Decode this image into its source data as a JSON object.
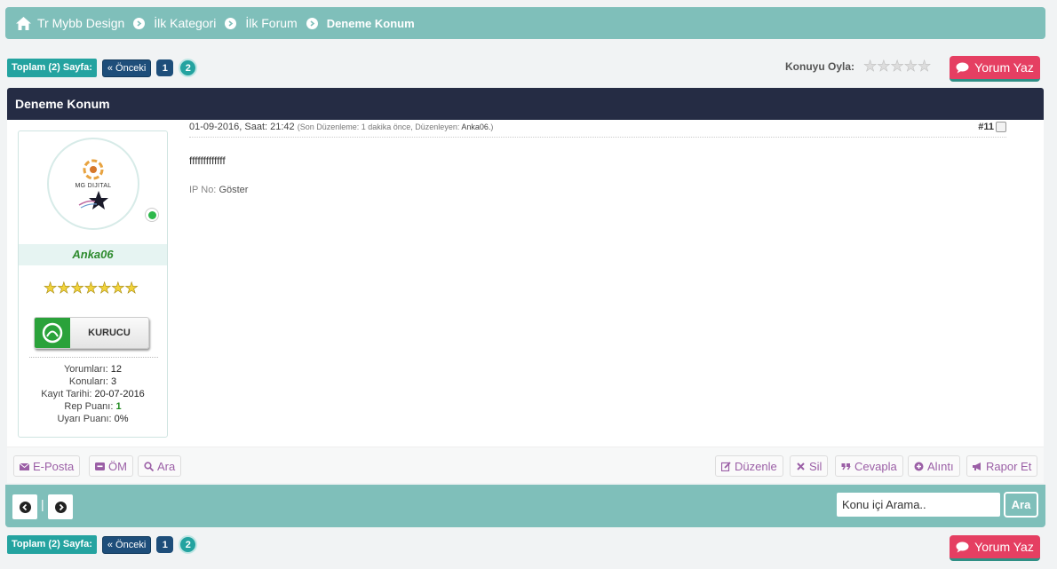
{
  "breadcrumb": {
    "items": [
      "Tr Mybb Design",
      "İlk Kategori",
      "İlk Forum"
    ],
    "current": "Deneme Konum"
  },
  "pagination": {
    "label": "Toplam (2) Sayfa:",
    "prev": "« Önceki",
    "pages": [
      "1",
      "2"
    ],
    "current_page": "2"
  },
  "rating": {
    "label": "Konuyu Oyla:",
    "stars_total": 5,
    "stars_filled": 0
  },
  "reply_button": "Yorum Yaz",
  "post": {
    "thread_title": "Deneme Konum",
    "date": "01-09-2016, Saat: 21:42",
    "edit_info": "(Son Düzenleme: 1 dakika önce, Düzenleyen:",
    "edit_user": "Anka06.",
    "edit_close": ")",
    "number": "#11",
    "content": "fffffffffffff",
    "ip_label": "IP No:",
    "ip_value": "Göster"
  },
  "author": {
    "avatar_text": "MG DIJITAL",
    "username": "Anka06",
    "online": true,
    "stars": 7,
    "rank": "KURUCU",
    "stats": {
      "posts_label": "Yorumları:",
      "posts": "12",
      "threads_label": "Konuları:",
      "threads": "3",
      "reg_label": "Kayıt Tarihi:",
      "reg": "20-07-2016",
      "rep_label": "Rep Puanı:",
      "rep": "1",
      "warn_label": "Uyarı Puanı:",
      "warn": "0%"
    }
  },
  "actions": {
    "email": "E-Posta",
    "pm": "ÖM",
    "search": "Ara",
    "edit": "Düzenle",
    "delete": "Sil",
    "reply": "Cevapla",
    "quote": "Alıntı",
    "report": "Rapor Et"
  },
  "thread_search": {
    "placeholder": "Konu içi Arama..",
    "button": "Ara",
    "separator": "|"
  },
  "colors": {
    "accent": "#7fbfba",
    "header": "#252c44",
    "reply": "#e53f62",
    "action_text": "#9b5fa6"
  }
}
